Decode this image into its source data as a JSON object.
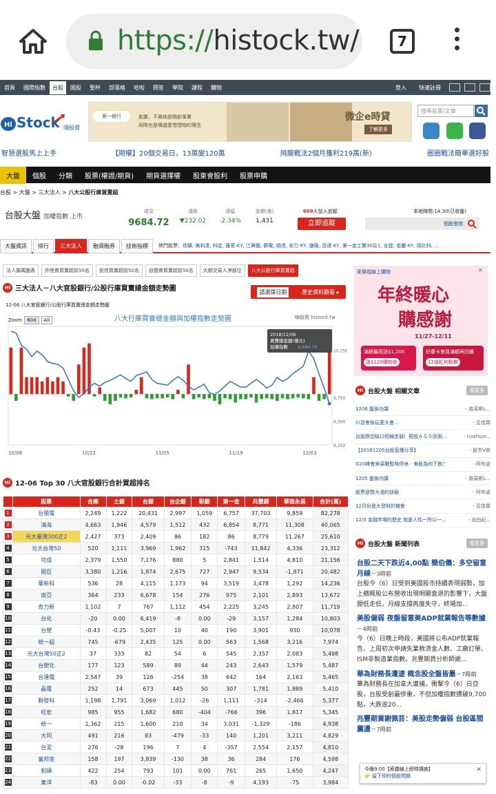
{
  "browser": {
    "url_scheme": "https://",
    "url_host": "histock.tw/",
    "tab_count": "7"
  },
  "topbar": {
    "items": [
      "首頁",
      "國際指數",
      "台股",
      "國股",
      "聖杯",
      "部落格",
      "哈啦",
      "問答",
      "學院",
      "課程",
      "購物"
    ],
    "active_index": 2,
    "login": "登入",
    "register": "快速註冊"
  },
  "search": {
    "placeholder": "搜尋股票/文章"
  },
  "marquee": [
    "智慧選股馬上上手",
    "【期權】20個交易日，13萬變120萬",
    "飛龍戰法2個月獲利219萬(新)",
    "圈圈戰法簡單選好股"
  ],
  "banner": {
    "bank": "第一銀行",
    "line1": "創業，不單純是開創事業",
    "line2": "同時也是傳遞愛惜惜物的理念",
    "title": "微企e時貸",
    "cta": "了解更多"
  },
  "mainnav": {
    "items": [
      "大盤",
      "個股",
      "分類",
      "股票(權證/期貨)",
      "期貨選擇權",
      "股東會股利",
      "股票申購"
    ],
    "active_index": 0
  },
  "breadcrumb": {
    "prefix": "台股 > 大盤 > 三大法人 > ",
    "current": "八大公股行庫買賣超"
  },
  "index": {
    "name": "台股大盤",
    "sub": "加權指數 上市",
    "cols": [
      {
        "label": "成交",
        "value": "9684.72"
      },
      {
        "label": "漲跌",
        "value": "▼232.02"
      },
      {
        "label": "漲幅",
        "value": "-2.34%"
      },
      {
        "label": "金額(億)",
        "value": "1,431"
      }
    ],
    "follow_count": "669",
    "follow_text": "人加入追蹤",
    "follow_btn": "立即追蹤",
    "time": "本地時間:14:30(已收盤)",
    "stock_query": "個股查詢"
  },
  "subnav": {
    "tabs": [
      "大盤資訊",
      "排行",
      "三大法人",
      "融資融券",
      "技術指標"
    ],
    "active_index": 2,
    "hot_label": "熱門股票：",
    "hot": "信驊, 美利達, 科定, 雅茗-KY, 江興鍛, 群電, 順達, 安力-KY, 謙薩, 百達-KY, 第一金工業30反1, 全銓, 金麗-KY, 頎比科, ..."
  },
  "tabs2": {
    "items": [
      "法人籌碼圖表",
      "外陸資買賣超前50名",
      "投信買賣超前50名",
      "自營商買賣超前50名",
      "大額交易人淨部位",
      "八大公股行庫買賣超"
    ],
    "active_index": 5
  },
  "section1": {
    "icon": "Hi",
    "title": "三大法人－八大官股銀行/公股行庫買賣總金額走勢圖",
    "date_btn": "請選擇日期",
    "history_btn": "歷史資料觀看 ▸"
  },
  "chart_data": {
    "type": "bar+line",
    "title": "八大行庫買賣總金額與加權指數走勢圖",
    "subtitle": "12-06 八大官股銀行/公股行庫買賣總金額走勢圖",
    "credit": "嗨投資 histock.tw",
    "zoom_label": "Zoom",
    "zoom_options": [
      "60d",
      "All"
    ],
    "x_ticks": [
      "10/08",
      "10/22",
      "11/05",
      "11/19",
      "12/03"
    ],
    "y_right_ticks": [
      "10,250",
      "9,750",
      "9,500",
      "9,250"
    ],
    "tooltip": {
      "date": "2018/12/06",
      "line1_label": "買賣總金額(億元)",
      "line2_label": "加權指數",
      "line2_value": "9,684.72"
    },
    "bar_values": [
      55,
      -8,
      55,
      20,
      20,
      20,
      15,
      20,
      15,
      20,
      15,
      -3,
      -8,
      35,
      55,
      60,
      -3,
      8,
      -8,
      -12,
      -8,
      -4,
      -5,
      -4,
      5,
      20,
      -5,
      -6,
      -5,
      -5,
      -4,
      -6,
      5,
      -5,
      35,
      -6,
      -4,
      -6,
      -5,
      -8,
      -12,
      -5,
      -6,
      -10,
      -6,
      -6,
      -4,
      -10,
      -6,
      -5,
      -6,
      -8,
      -5,
      -6,
      -5,
      -4,
      -5,
      -6,
      20,
      -8,
      -6,
      50
    ],
    "line_values": [
      10450,
      10430,
      10300,
      10260,
      10180,
      10240,
      10200,
      10130,
      10110,
      10100,
      10060,
      9940,
      9820,
      9750,
      9790,
      9860,
      9900,
      9870,
      9910,
      9930,
      9960,
      9990,
      9950,
      9920,
      9980,
      10000,
      10020,
      9940,
      9900,
      9890,
      9880,
      9930,
      9970,
      9930,
      9870,
      9830,
      9860,
      9890,
      9800,
      9780,
      9820,
      9870,
      9920,
      9890,
      9860,
      9860,
      9900,
      9940,
      9900,
      9850,
      9880,
      9960,
      9920,
      9950,
      10000,
      10040,
      10080,
      10240,
      10160,
      10000,
      9850,
      9684
    ],
    "ylim_line": [
      9250,
      10500
    ],
    "ylim_bar": [
      -60,
      80
    ],
    "colors": {
      "bar_pos": "#d9261c",
      "bar_neg": "#2a9d2a",
      "line": "#3a7bbf"
    }
  },
  "section2": {
    "title": "12-06 Top 30 八大官股銀行合計買超排名"
  },
  "table": {
    "headers": [
      "",
      "股票",
      "合庫",
      "土銀",
      "台銀",
      "台企銀",
      "彰銀",
      "第一金",
      "兆豐銀",
      "華南永昌",
      "合計(萬)"
    ],
    "rows": [
      [
        "1",
        "台積電",
        "2,249",
        "1,222",
        "20,431",
        "2,997",
        "1,059",
        "6,757",
        "37,703",
        "9,859",
        "82,278"
      ],
      [
        "2",
        "鴻海",
        "4,663",
        "1,946",
        "4,579",
        "1,512",
        "432",
        "6,854",
        "8,771",
        "11,308",
        "40,065"
      ],
      [
        "3",
        "元大臺灣300正2",
        "2,427",
        "373",
        "2,409",
        "86",
        "182",
        "86",
        "8,779",
        "11,267",
        "25,610"
      ],
      [
        "4",
        "元大台灣50",
        "520",
        "1,111",
        "3,969",
        "1,962",
        "315",
        "-743",
        "11,842",
        "4,336",
        "23,312"
      ],
      [
        "5",
        "可成",
        "2,379",
        "1,550",
        "7,176",
        "880",
        "5",
        "2,841",
        "1,514",
        "4,810",
        "21,156"
      ],
      [
        "6",
        "國巨",
        "3,380",
        "1,216",
        "1,874",
        "2,675",
        "727",
        "2,947",
        "9,534",
        "-1,871",
        "20,482"
      ],
      [
        "7",
        "華新科",
        "536",
        "28",
        "4,115",
        "1,173",
        "94",
        "3,519",
        "3,478",
        "1,292",
        "14,236"
      ],
      [
        "8",
        "南亞",
        "364",
        "233",
        "6,678",
        "154",
        "276",
        "975",
        "2,101",
        "2,893",
        "13,672"
      ],
      [
        "9",
        "奇力新",
        "1,102",
        "7",
        "767",
        "1,112",
        "454",
        "2,225",
        "3,245",
        "2,807",
        "11,719"
      ],
      [
        "10",
        "台化",
        "-20",
        "0.00",
        "6,419",
        "-8",
        "0.00",
        "-29",
        "3,157",
        "1,284",
        "10,803"
      ],
      [
        "11",
        "台塑",
        "-0.43",
        "-0.25",
        "5,007",
        "10",
        "40",
        "190",
        "3,901",
        "930",
        "10,078"
      ],
      [
        "12",
        "統一超",
        "745",
        "-679",
        "2,435",
        "125",
        "0.00",
        "563",
        "1,568",
        "3,216",
        "7,974"
      ],
      [
        "13",
        "元大台灣50正2",
        "37",
        "333",
        "82",
        "54",
        "6",
        "545",
        "2,357",
        "2,083",
        "5,498"
      ],
      [
        "14",
        "台塑化",
        "177",
        "123",
        "589",
        "89",
        "44",
        "243",
        "2,643",
        "1,579",
        "5,487"
      ],
      [
        "15",
        "台達電",
        "2,547",
        "39",
        "126",
        "-254",
        "38",
        "642",
        "164",
        "2,163",
        "5,465"
      ],
      [
        "16",
        "晶電",
        "252",
        "14",
        "673",
        "445",
        "50",
        "307",
        "1,781",
        "1,889",
        "5,410"
      ],
      [
        "17",
        "聯發科",
        "1,198",
        "1,791",
        "3,069",
        "1,012",
        "-26",
        "1,111",
        "-314",
        "-2,466",
        "5,377"
      ],
      [
        "18",
        "旺宏",
        "985",
        "955",
        "1,682",
        "680",
        "-404",
        "-766",
        "396",
        "1,817",
        "5,345"
      ],
      [
        "19",
        "統一",
        "1,362",
        "215",
        "1,600",
        "210",
        "34",
        "3,031",
        "-1,329",
        "-186",
        "4,938"
      ],
      [
        "20",
        "大同",
        "491",
        "216",
        "83",
        "-479",
        "-33",
        "140",
        "1,201",
        "3,211",
        "4,829"
      ],
      [
        "21",
        "台泥",
        "276",
        "-28",
        "196",
        "7",
        "4",
        "-357",
        "2,554",
        "2,157",
        "4,810"
      ],
      [
        "22",
        "富邦金",
        "158",
        "197",
        "3,839",
        "-130",
        "38",
        "36",
        "284",
        "176",
        "4,598"
      ],
      [
        "23",
        "和碩",
        "422",
        "254",
        "793",
        "101",
        "0.00",
        "761",
        "265",
        "1,650",
        "4,247"
      ],
      [
        "24",
        "東洋",
        "-83",
        "0.00",
        "-0.02",
        "-33",
        "-8",
        "-9",
        "4,193",
        "-75",
        "3,984"
      ]
    ]
  },
  "ad": {
    "brand": "家樂福線上購物",
    "line1": "年終暖心",
    "line2": "購感謝",
    "dates": "11/27-12/11",
    "promo1": "滿額最高送$1,200",
    "promo2": "送$120購物金",
    "promo3": "好康卡會員滿額再回饋",
    "promo4": "12倍紅利點數"
  },
  "related": {
    "title": "台股大盤 相關文章",
    "more": "看更多",
    "items": [
      {
        "t": "1206 盤後功課",
        "s": "- 路易斯L..."
      },
      {
        "t": "川習會後玩更大會...",
        "s": "- 呂佳霖"
      },
      {
        "t": "台股跌空缺口短線走弱！預設ＡＳ０回測...",
        "s": "- noahsar..."
      },
      {
        "t": "【20181205台股直播分享】",
        "s": "- 股市V爸"
      },
      {
        "t": "G20峰會貿易戰暫時停休 - 美股為何下跌？",
        "s": "- 阿布波"
      },
      {
        "t": "1205 盤後功課",
        "s": "- 路易斯L..."
      },
      {
        "t": "股票逆勢大漲的訣竅",
        "s": "- 阿布波"
      },
      {
        "t": "12月份是大發財的機會",
        "s": "- 呂佳霖"
      },
      {
        "t": "12/5 金融市場的歷史 就是人性一所以一...",
        "s": "- 自由紀..."
      }
    ]
  },
  "newsfeed": {
    "title": "台股大盤 新聞列表",
    "more": "看更多",
    "items": [
      {
        "t": "台股二天下跌近4,00點 簡伯儀：多空留意月線",
        "ago": "－3時前",
        "b": "台股今（6）日受到美國股市持續表現弱勢，加上蘋概股公布營收出現明顯衰退的影響下，大盤開低走低，月線支撐再度失守，終場加..."
      },
      {
        "t": "美股偏弱 夜盤留意美ADP就業報告等數據",
        "ago": "－4時前",
        "b": "今（6）日晚上時段，美國將公布ADP就業報告、上周初次申請失業救濟金人數、工廠訂單、ISM非製造業指數。兆豐期貨分析師謝..."
      },
      {
        "t": "華為財務長遭逮 概念股全盤皆墨",
        "ago": "－7時前",
        "b": "華為財務長在加拿大遭捕，衝擊今（6）日亞股，台股受創最慘重，不但加權指數摜破9,700點，大跌逾20..."
      },
      {
        "t": "兆豐期貨謝佩芸：美股走勢偏弱 台股區間震盪",
        "ago": "－7時前",
        "b": ""
      }
    ]
  },
  "toast": {
    "line1": "今晚9:00【索趨線上即時講座】",
    "line2": "👉 留下你的個股問題"
  }
}
